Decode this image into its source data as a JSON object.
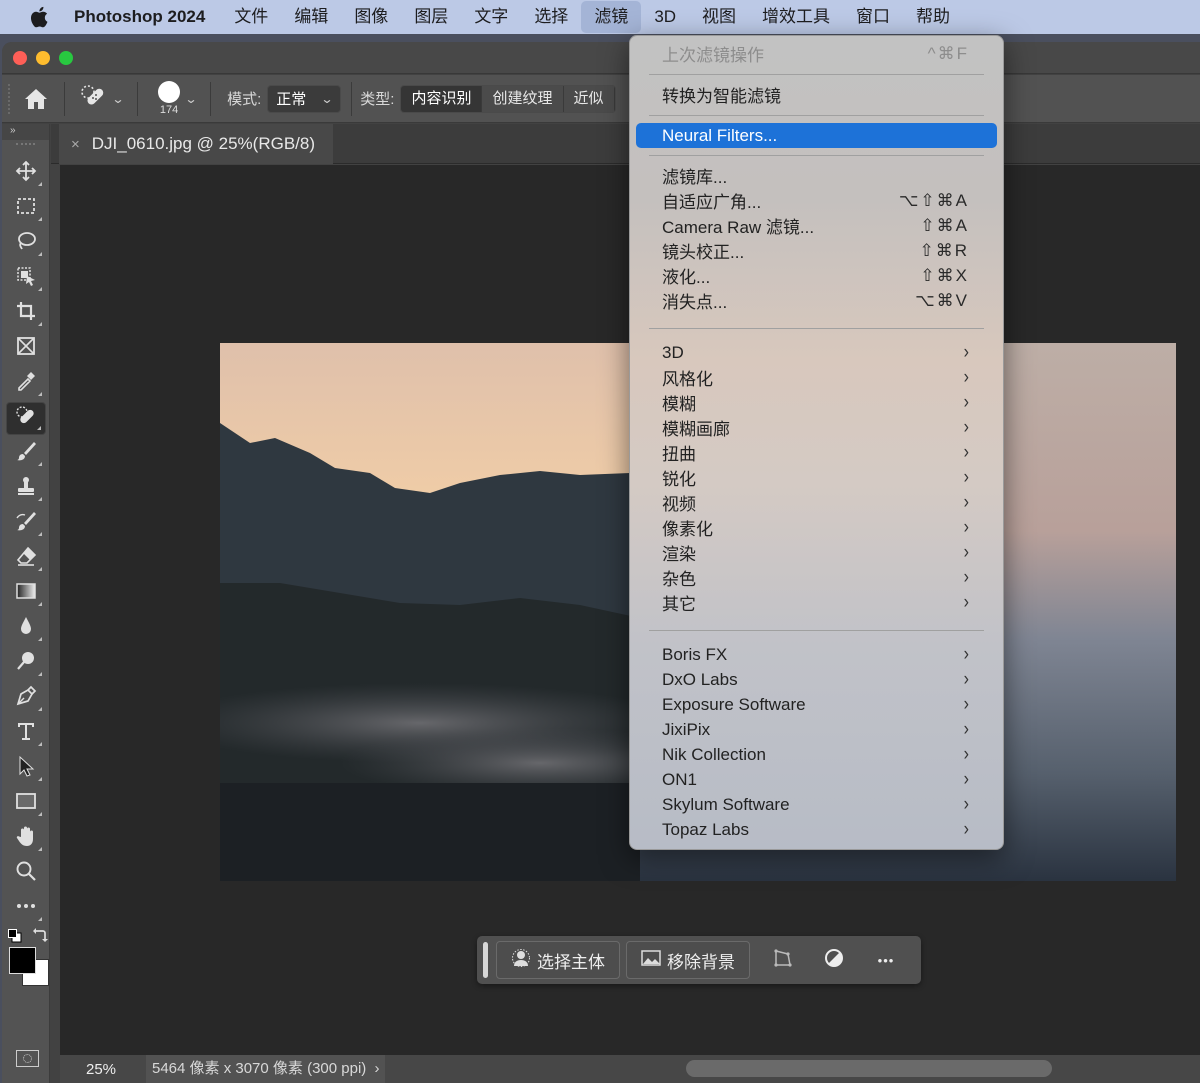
{
  "menubar": {
    "app_name": "Photoshop 2024",
    "items": [
      "文件",
      "编辑",
      "图像",
      "图层",
      "文字",
      "选择",
      "滤镜",
      "3D",
      "视图",
      "增效工具",
      "窗口",
      "帮助"
    ],
    "active_item": "滤镜"
  },
  "options_bar": {
    "brush_size": "174",
    "mode_label": "模式:",
    "mode_value": "正常",
    "type_label": "类型:",
    "type_options": [
      "内容识别",
      "创建纹理",
      "近似"
    ],
    "type_selected": "内容识别"
  },
  "tools_panel": {
    "collapse_label": "»",
    "tools": [
      {
        "name": "move-tool",
        "active": false
      },
      {
        "name": "marquee-tool",
        "active": false
      },
      {
        "name": "lasso-tool",
        "active": false
      },
      {
        "name": "object-selection-tool",
        "active": false
      },
      {
        "name": "crop-tool",
        "active": false
      },
      {
        "name": "frame-tool",
        "active": false
      },
      {
        "name": "eyedropper-tool",
        "active": false
      },
      {
        "name": "spot-healing-brush-tool",
        "active": true
      },
      {
        "name": "brush-tool",
        "active": false
      },
      {
        "name": "clone-stamp-tool",
        "active": false
      },
      {
        "name": "history-brush-tool",
        "active": false
      },
      {
        "name": "eraser-tool",
        "active": false
      },
      {
        "name": "gradient-tool",
        "active": false
      },
      {
        "name": "blur-tool",
        "active": false
      },
      {
        "name": "dodge-tool",
        "active": false
      },
      {
        "name": "pen-tool",
        "active": false
      },
      {
        "name": "type-tool",
        "active": false
      },
      {
        "name": "path-selection-tool",
        "active": false
      },
      {
        "name": "rectangle-tool",
        "active": false
      },
      {
        "name": "hand-tool",
        "active": false
      },
      {
        "name": "zoom-tool",
        "active": false
      },
      {
        "name": "more-tools",
        "active": false
      }
    ],
    "foreground_color": "#000000",
    "background_color": "#ffffff"
  },
  "document": {
    "tab_title": "DJI_0610.jpg @ 25%(RGB/8)",
    "close_label": "×"
  },
  "context_taskbar": {
    "select_subject_label": "选择主体",
    "remove_background_label": "移除背景",
    "more_label": "•••"
  },
  "status_bar": {
    "zoom": "25%",
    "doc_info": "5464 像素 x 3070 像素 (300 ppi)",
    "doc_info_arrow": "›"
  },
  "filter_menu": {
    "sections": [
      {
        "items": [
          {
            "label": "上次滤镜操作",
            "shortcut": "^⌘F",
            "disabled": true
          }
        ]
      },
      {
        "items": [
          {
            "label": "转换为智能滤镜",
            "shortcut": ""
          }
        ]
      },
      {
        "items": [
          {
            "label": "Neural Filters...",
            "shortcut": "",
            "highlighted": true
          }
        ]
      },
      {
        "items": [
          {
            "label": "滤镜库...",
            "shortcut": ""
          },
          {
            "label": "自适应广角...",
            "shortcut": "⌥⇧⌘A"
          },
          {
            "label": "Camera Raw 滤镜...",
            "shortcut": "⇧⌘A"
          },
          {
            "label": "镜头校正...",
            "shortcut": "⇧⌘R"
          },
          {
            "label": "液化...",
            "shortcut": "⇧⌘X"
          },
          {
            "label": "消失点...",
            "shortcut": "⌥⌘V"
          }
        ]
      },
      {
        "items": [
          {
            "label": "3D",
            "submenu": true
          },
          {
            "label": "风格化",
            "submenu": true
          },
          {
            "label": "模糊",
            "submenu": true
          },
          {
            "label": "模糊画廊",
            "submenu": true
          },
          {
            "label": "扭曲",
            "submenu": true
          },
          {
            "label": "锐化",
            "submenu": true
          },
          {
            "label": "视频",
            "submenu": true
          },
          {
            "label": "像素化",
            "submenu": true
          },
          {
            "label": "渲染",
            "submenu": true
          },
          {
            "label": "杂色",
            "submenu": true
          },
          {
            "label": "其它",
            "submenu": true
          }
        ]
      },
      {
        "items": [
          {
            "label": "Boris FX",
            "submenu": true
          },
          {
            "label": "DxO Labs",
            "submenu": true
          },
          {
            "label": "Exposure Software",
            "submenu": true
          },
          {
            "label": "JixiPix",
            "submenu": true
          },
          {
            "label": "Nik Collection",
            "submenu": true
          },
          {
            "label": "ON1",
            "submenu": true
          },
          {
            "label": "Skylum Software",
            "submenu": true
          },
          {
            "label": "Topaz Labs",
            "submenu": true
          }
        ]
      }
    ],
    "submenu_arrow": "›",
    "highlight_color": "#1d72d8"
  }
}
